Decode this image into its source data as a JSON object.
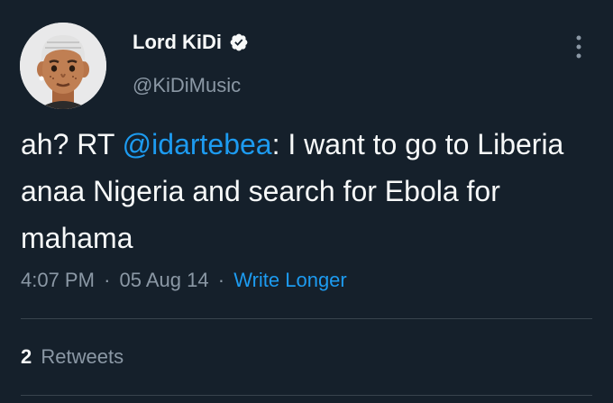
{
  "user": {
    "display_name": "Lord KiDi",
    "handle": "@KiDiMusic",
    "verified": true
  },
  "tweet": {
    "text_prefix": "ah? RT ",
    "mention": "@idartebea",
    "text_suffix": ": I want to go to Liberia anaa Nigeria and search for Ebola for mahama",
    "time": "4:07 PM",
    "date": "05 Aug 14",
    "separator": "·",
    "source": "Write Longer"
  },
  "stats": {
    "retweets_count": "2",
    "retweets_label": "Retweets"
  },
  "icons": {
    "verified": "verified-badge-icon",
    "more": "more-vertical-icon"
  },
  "colors": {
    "background": "#15202b",
    "text": "#f7f9f9",
    "secondary": "#8b98a5",
    "accent": "#1d9bf0",
    "divider": "#38444d"
  }
}
